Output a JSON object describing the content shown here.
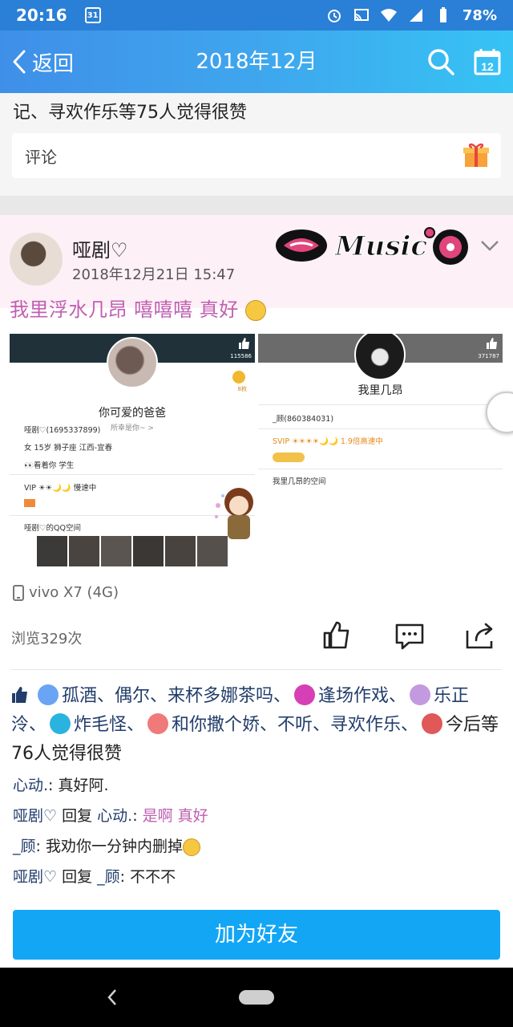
{
  "status_bar": {
    "time": "20:16",
    "calendar_day": "31",
    "battery": "78%",
    "icons": [
      "alarm-icon",
      "cast-icon",
      "wifi-icon",
      "signal-icon",
      "battery-icon"
    ]
  },
  "nav": {
    "back_label": "返回",
    "title": "2018年12月",
    "calendar_badge": "12"
  },
  "previous_post": {
    "likes_text": "记、寻欢作乐等75人觉得很赞",
    "comment_label": "评论"
  },
  "post": {
    "username": "哑剧♡",
    "timestamp": "2018年12月21日 15:47",
    "badge_text": "Music",
    "text": "我里浮水几昂  嘻嘻嘻  真好",
    "device": "vivo X7 (4G)",
    "views": "浏览329次",
    "screenshot_left": {
      "name": "你可爱的爸爸",
      "subtitle": "所幸是你~ >",
      "count": "115586",
      "badge_count": "8枚",
      "rows": [
        "哑剧♡(1695337899)",
        "女  15岁  狮子座  江西-宜春",
        "👀看着你  学生",
        "VIP  ☀☀🌙🌙  慢速中",
        "",
        "哑剧♡的QQ空间"
      ]
    },
    "screenshot_right": {
      "name": "我里几昂",
      "count": "371787",
      "rows": [
        "_顾(860384031)",
        "SVIP  ☀☀☀☀🌙🌙  1.9倍高速中",
        "",
        "我里几昂的空间"
      ]
    }
  },
  "likes": {
    "names": [
      "孤酒",
      "偶尔",
      "来杯多娜茶吗",
      "逢场作戏",
      "乐正泠",
      "炸毛怪",
      "和你撒个娇",
      "不听",
      "寻欢作乐",
      "今后"
    ],
    "text_1": "孤酒、偶尔、来杯多娜茶吗、",
    "text_2": "逢场作戏、",
    "text_3": "乐正泠、",
    "text_4": "炸毛怪、",
    "text_5": "和你撒个娇、不听、寻欢作乐、",
    "text_6": "今后等76人觉得很赞",
    "icon_colors": [
      "#6aa4f4",
      "#d63fb6",
      "#c39ae0",
      "#2bb3e0",
      "#f07a7a",
      "#e05858"
    ]
  },
  "comments": [
    {
      "user": "心动.",
      "text": ": 真好阿."
    },
    {
      "user": "哑剧♡",
      "reply_word": " 回复 ",
      "target": "心动.",
      "text": "是啊 真好"
    },
    {
      "user": "_顾",
      "text": ": 我劝你一分钟内删掉"
    },
    {
      "user": "哑剧♡",
      "reply_word": " 回复 ",
      "target": "_顾",
      "text": ": 不不不"
    }
  ],
  "add_friend_label": "加为好友"
}
